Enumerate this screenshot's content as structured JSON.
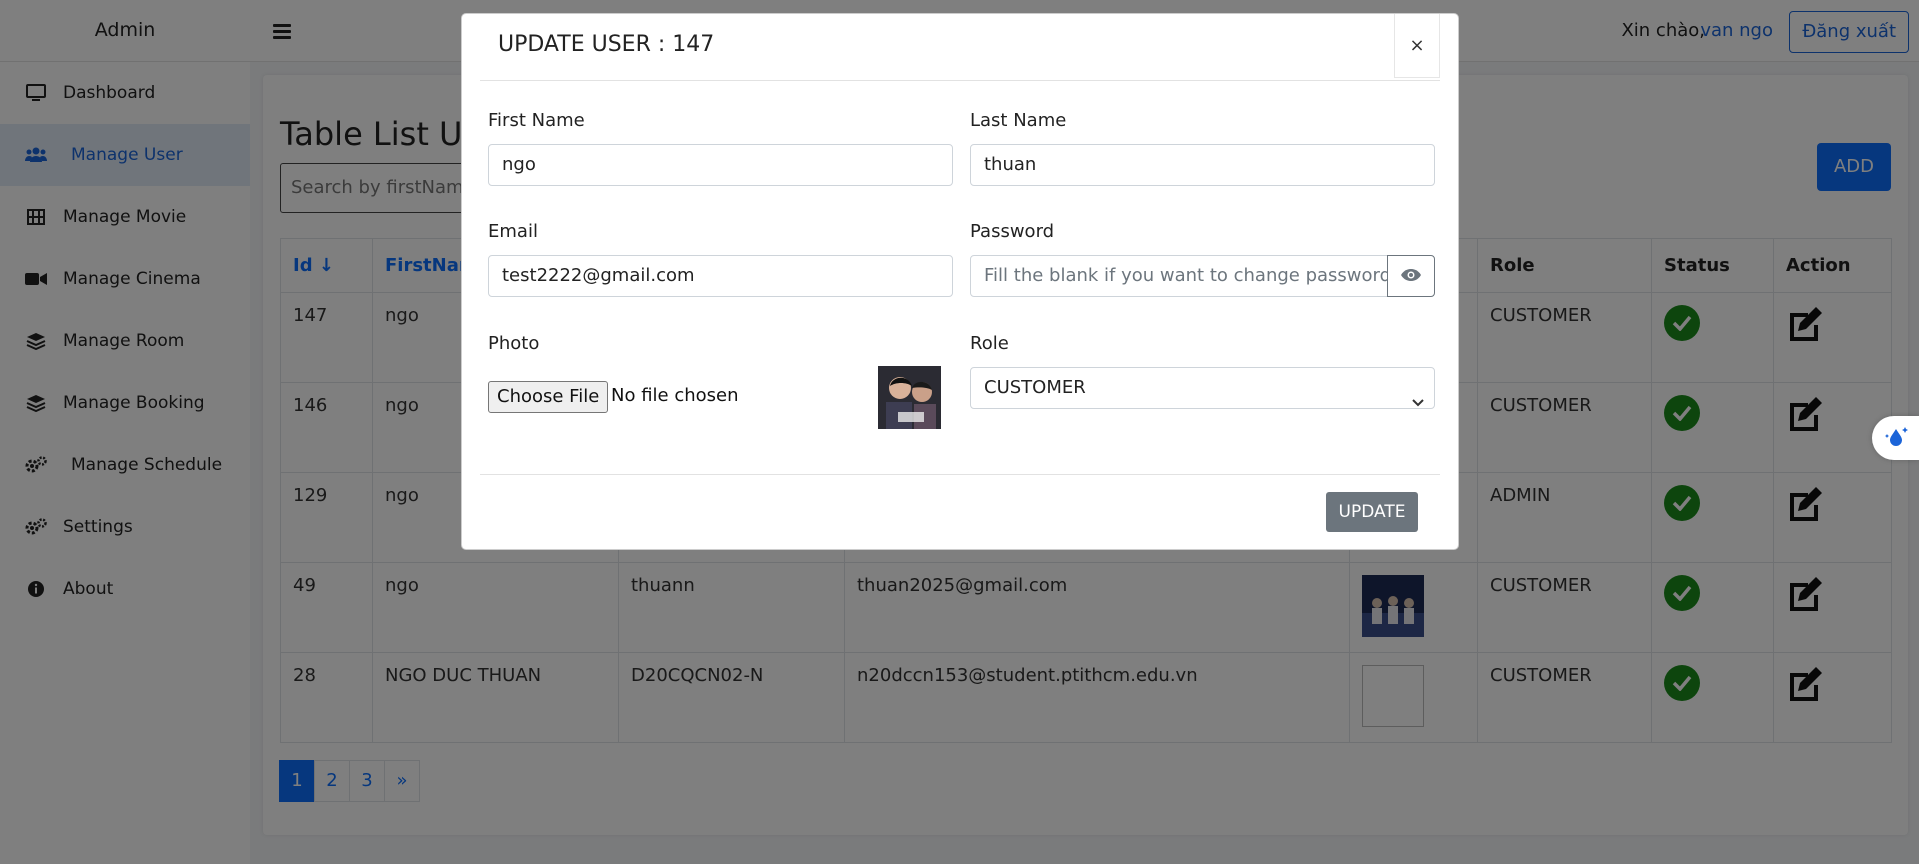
{
  "sidebar": {
    "brand": "Admin",
    "items": [
      {
        "label": "Dashboard",
        "icon": "monitor-icon"
      },
      {
        "label": "Manage User",
        "icon": "users-icon",
        "active": true
      },
      {
        "label": "Manage Movie",
        "icon": "film-icon"
      },
      {
        "label": "Manage Cinema",
        "icon": "video-camera-icon"
      },
      {
        "label": "Manage Room",
        "icon": "layers-icon"
      },
      {
        "label": "Manage Booking",
        "icon": "layers-icon"
      },
      {
        "label": "Manage Schedule",
        "icon": "gears-icon"
      },
      {
        "label": "Settings",
        "icon": "gears-icon"
      },
      {
        "label": "About",
        "icon": "info-circle-icon"
      }
    ]
  },
  "header": {
    "greeting": "Xin chào,",
    "username": "van ngo",
    "logout_label": "Đăng xuất"
  },
  "main": {
    "title": "Table List Us",
    "search_placeholder": "Search by firstName,",
    "add_label": "ADD",
    "table": {
      "headers": {
        "id": "Id",
        "firstname": "FirstNam",
        "role": "Role",
        "status": "Status",
        "action": "Action"
      },
      "rows": [
        {
          "id": "147",
          "firstname": "ngo",
          "lastname": "",
          "email": "",
          "role": "CUSTOMER"
        },
        {
          "id": "146",
          "firstname": "ngo",
          "lastname": "",
          "email": "",
          "role": "CUSTOMER"
        },
        {
          "id": "129",
          "firstname": "ngo",
          "lastname": "",
          "email": "",
          "role": "ADMIN"
        },
        {
          "id": "49",
          "firstname": "ngo",
          "lastname": "thuann",
          "email": "thuan2025@gmail.com",
          "role": "CUSTOMER"
        },
        {
          "id": "28",
          "firstname": "NGO DUC THUAN",
          "lastname": "D20CQCN02-N",
          "email": "n20dccn153@student.ptithcm.edu.vn",
          "role": "CUSTOMER"
        }
      ]
    },
    "pagination": [
      "1",
      "2",
      "3",
      "»"
    ]
  },
  "modal": {
    "title": "UPDATE USER : 147",
    "close_label": "×",
    "first_name_label": "First Name",
    "first_name_value": "ngo",
    "last_name_label": "Last Name",
    "last_name_value": "thuan",
    "email_label": "Email",
    "email_value": "test2222@gmail.com",
    "password_label": "Password",
    "password_placeholder": "Fill the blank if you want to change password",
    "photo_label": "Photo",
    "choose_file_label": "Choose File",
    "no_file_label": "No file chosen",
    "role_label": "Role",
    "role_value": "CUSTOMER",
    "update_label": "UPDATE"
  },
  "colors": {
    "accent": "#0d6efd",
    "status_ok": "#1a8a1a",
    "update_button": "#6c757d"
  }
}
